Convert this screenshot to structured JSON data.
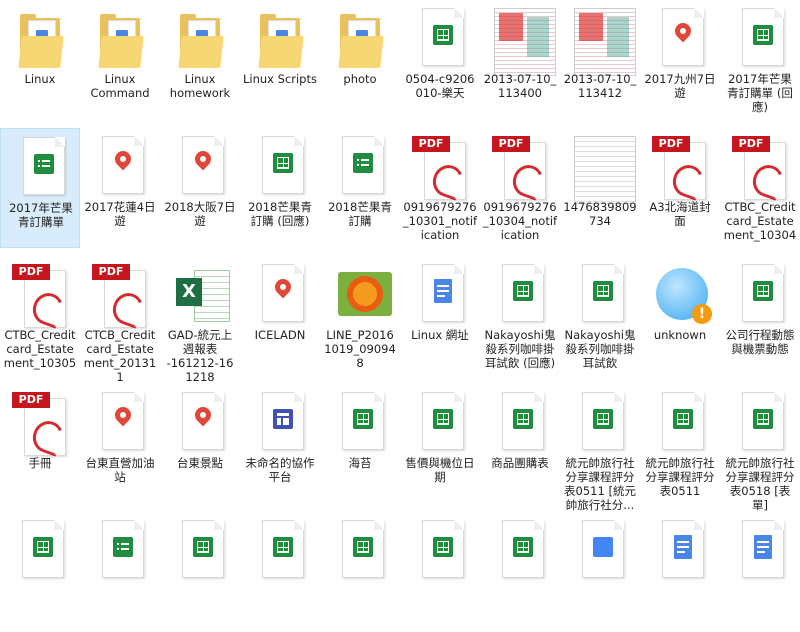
{
  "files": [
    {
      "type": "folder",
      "label": "Linux",
      "icon": "folder-icon"
    },
    {
      "type": "folder",
      "label": "Linux\nCommand",
      "icon": "folder-icon"
    },
    {
      "type": "folder",
      "label": "Linux\nhomework",
      "icon": "folder-icon"
    },
    {
      "type": "folder",
      "label": "Linux Scripts",
      "icon": "folder-icon"
    },
    {
      "type": "folder",
      "label": "photo",
      "icon": "folder-icon"
    },
    {
      "type": "sheets",
      "label": "0504-c9206\n010-樂天",
      "icon": "google-sheets-icon"
    },
    {
      "type": "img-red",
      "label": "2013-07-10_\n113400",
      "icon": "image-thumbnail-icon"
    },
    {
      "type": "img-red",
      "label": "2013-07-10_\n113412",
      "icon": "image-thumbnail-icon"
    },
    {
      "type": "map",
      "label": "2017九州7日\n遊",
      "icon": "google-maps-icon"
    },
    {
      "type": "sheets",
      "label": "2017年芒果\n青訂購單 (回\n應)",
      "icon": "google-sheets-icon"
    },
    {
      "type": "form",
      "label": "2017年芒果\n青訂購單",
      "icon": "google-forms-icon",
      "selected": true
    },
    {
      "type": "map",
      "label": "2017花蓮4日\n遊",
      "icon": "google-maps-icon"
    },
    {
      "type": "map",
      "label": "2018大阪7日\n遊",
      "icon": "google-maps-icon"
    },
    {
      "type": "sheets",
      "label": "2018芒果青\n訂購 (回應)",
      "icon": "google-sheets-icon"
    },
    {
      "type": "form",
      "label": "2018芒果青\n訂購",
      "icon": "google-forms-icon"
    },
    {
      "type": "pdf",
      "label": "0919679276\n_10301_notif\nication",
      "icon": "pdf-icon"
    },
    {
      "type": "pdf",
      "label": "0919679276\n_10304_notif\nication",
      "icon": "pdf-icon"
    },
    {
      "type": "img-scan",
      "label": "1476839809\n734",
      "icon": "image-thumbnail-icon"
    },
    {
      "type": "pdf",
      "label": "A3北海道封\n面",
      "icon": "pdf-icon"
    },
    {
      "type": "pdf",
      "label": "CTBC_Credit\ncard_Estate\nment_10304",
      "icon": "pdf-icon"
    },
    {
      "type": "pdf",
      "label": "CTBC_Credit\ncard_Estate\nment_10305",
      "icon": "pdf-icon"
    },
    {
      "type": "pdf",
      "label": "CTCB_Credit\ncard_Estate\nment_20131\n1",
      "icon": "pdf-icon"
    },
    {
      "type": "excel",
      "label": "GAD-統元上\n週報表\n-161212-16\n1218",
      "icon": "excel-icon"
    },
    {
      "type": "map",
      "label": "ICELADN",
      "icon": "google-maps-icon"
    },
    {
      "type": "img-flower",
      "label": "LINE_P2016\n1019_09094\n8",
      "icon": "photo-flower-icon"
    },
    {
      "type": "docs",
      "label": "Linux 網址",
      "icon": "google-docs-icon"
    },
    {
      "type": "sheets",
      "label": "Nakayoshi鬼\n殺系列咖啡掛\n耳試飲 (回應)",
      "icon": "google-sheets-icon"
    },
    {
      "type": "sheets",
      "label": "Nakayoshi鬼\n殺系列咖啡掛\n耳試飲",
      "icon": "google-sheets-icon"
    },
    {
      "type": "unknown",
      "label": "unknown",
      "icon": "unknown-file-warning-icon"
    },
    {
      "type": "sheets",
      "label": "公司行程動態\n與機票動態",
      "icon": "google-sheets-icon"
    },
    {
      "type": "pdf",
      "label": "手冊",
      "icon": "pdf-icon"
    },
    {
      "type": "map",
      "label": "台東直營加油\n站",
      "icon": "google-maps-icon"
    },
    {
      "type": "map",
      "label": "台東景點",
      "icon": "google-maps-icon"
    },
    {
      "type": "slides",
      "label": "未命名的協作\n平台",
      "icon": "google-sites-icon"
    },
    {
      "type": "sheets",
      "label": "海苔",
      "icon": "google-sheets-icon"
    },
    {
      "type": "sheets",
      "label": "售價與機位日\n期",
      "icon": "google-sheets-icon"
    },
    {
      "type": "sheets",
      "label": "商品團購表",
      "icon": "google-sheets-icon"
    },
    {
      "type": "sheets",
      "label": "統元帥旅行社\n分享課程評分\n表0511 [統元\n帥旅行社分...",
      "icon": "google-sheets-icon"
    },
    {
      "type": "sheets",
      "label": "統元帥旅行社\n分享課程評分\n表0511",
      "icon": "google-sheets-icon"
    },
    {
      "type": "sheets",
      "label": "統元帥旅行社\n分享課程評分\n表0518 [表\n單]",
      "icon": "google-sheets-icon"
    },
    {
      "type": "sheets",
      "label": "",
      "icon": "google-sheets-icon"
    },
    {
      "type": "form",
      "label": "",
      "icon": "google-forms-icon"
    },
    {
      "type": "sheets",
      "label": "",
      "icon": "google-sheets-icon"
    },
    {
      "type": "sheets",
      "label": "",
      "icon": "google-sheets-icon"
    },
    {
      "type": "sheets",
      "label": "",
      "icon": "google-sheets-icon"
    },
    {
      "type": "sheets",
      "label": "",
      "icon": "google-sheets-icon"
    },
    {
      "type": "sheets",
      "label": "",
      "icon": "google-sheets-icon"
    },
    {
      "type": "cal",
      "label": "",
      "icon": "calendar-icon"
    },
    {
      "type": "docs",
      "label": "",
      "icon": "google-docs-icon"
    },
    {
      "type": "docs",
      "label": "",
      "icon": "google-docs-icon"
    }
  ]
}
